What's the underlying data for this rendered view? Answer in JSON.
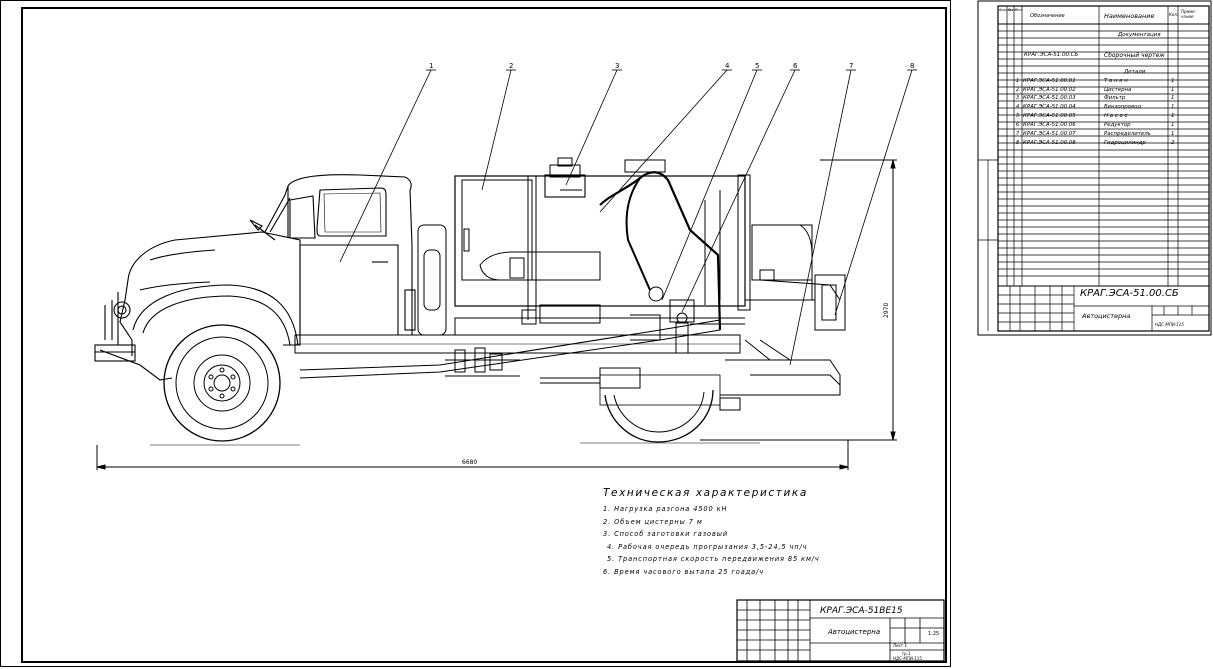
{
  "callouts": [
    "1",
    "2",
    "3",
    "4",
    "5",
    "6",
    "7",
    "8"
  ],
  "dimensions": {
    "length": "6680",
    "height": "2970"
  },
  "specs": {
    "title": "Техническая характеристика",
    "lines": [
      "1. Нагрузка разгона 4500 кН",
      "2. Объем цистерны 7 м",
      "3. Способ заготовки  газовый",
      "4. Рабочая очередь прогрызания 3,5-24,5 чп/ч",
      "5. Транспортная скорость передвижения 85 км/ч",
      "6. Время часового вытапа 25 гоада/ч"
    ]
  },
  "title_block": {
    "doc_code": "КРАГ.ЭСА-51ВЕ15",
    "name": "Автоцистерна",
    "scale": "1:25",
    "sheet_info": "Лист 1",
    "group": "гр.1",
    "org": "НДС-МПИ-115"
  },
  "spec_table": {
    "headers": [
      "Формат",
      "Зона",
      "Поз.",
      "Обозначение",
      "Наименование",
      "Кол.",
      "Приме-чание"
    ],
    "section_docs": "Документация",
    "assembly_code": "КРАГ.ЭСА-51.00.СБ",
    "assembly_name": "Сборочный чертеж",
    "section_parts": "Детали",
    "rows": [
      {
        "pos": "1",
        "code": "КРАГ.ЭСА-51.00.01",
        "name": "Т а н к н",
        "qty": "1"
      },
      {
        "pos": "2",
        "code": "КРАГ.ЭСА-51.00.02",
        "name": "Цистерна",
        "qty": "1"
      },
      {
        "pos": "3",
        "code": "КРАГ.ЭСА-51.00.03",
        "name": "Фильтр",
        "qty": "1"
      },
      {
        "pos": "4",
        "code": "КРАГ.ЭСА-51.00.04",
        "name": "Бензопровод",
        "qty": "1"
      },
      {
        "pos": "5",
        "code": "КРАГ.ЭСА-51.00.05",
        "name": "Н а с о с",
        "qty": "1"
      },
      {
        "pos": "6",
        "code": "КРАГ.ЭСА-51.00.06",
        "name": "Редуктор",
        "qty": "1"
      },
      {
        "pos": "7",
        "code": "КРАГ.ЭСА-51.00.07",
        "name": "Распределитель",
        "qty": "1"
      },
      {
        "pos": "8",
        "code": "КРАГ.ЭСА-51.00.08",
        "name": "Гидроцилиндр",
        "qty": "2"
      }
    ],
    "tb_code": "КРАГ.ЭСА-51.00.СБ",
    "tb_name": "Автоцистерна",
    "tb_org": "НДС-МПИ-115"
  }
}
